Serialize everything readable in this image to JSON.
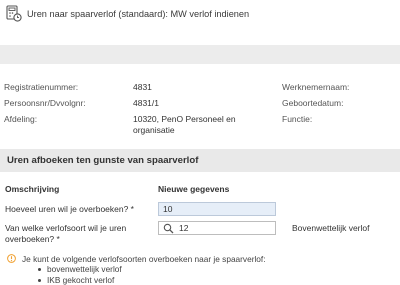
{
  "header": {
    "title": "Uren naar spaarverlof (standaard): MW verlof indienen",
    "icon": "calculator-clock-icon"
  },
  "info": {
    "registratienummer": {
      "label": "Registratienummer:",
      "value": "4831"
    },
    "persoonsnr": {
      "label": "Persoonsnr/Dvvolgnr:",
      "value": "4831/1"
    },
    "afdeling": {
      "label": "Afdeling:",
      "value_line1": "10320, PenO Personeel en",
      "value_line2": "organisatie"
    },
    "werknemernaam": {
      "label": "Werknemernaam:"
    },
    "geboortedatum": {
      "label": "Geboortedatum:"
    },
    "functie": {
      "label": "Functie:"
    }
  },
  "section": {
    "title": "Uren afboeken ten gunste van spaarverlof"
  },
  "form": {
    "col_omschrijving": "Omschrijving",
    "col_nieuwe_gegevens": "Nieuwe gegevens",
    "hours_label": "Hoeveel uren wil je overboeken? *",
    "hours_value": "10",
    "type_label_line1": "Van welke verlofsoort wil je uren",
    "type_label_line2": "overboeken? *",
    "type_value": "12",
    "type_description": "Bovenwettelijk verlof"
  },
  "notice": {
    "text": "Je kunt de volgende verlofsoorten overboeken naar je spaarverlof:",
    "items": [
      "bovenwettelijk verlof",
      "IKB gekocht verlof"
    ],
    "icon": "warning-circle-icon"
  },
  "colors": {
    "accent_orange": "#f0a030",
    "input_fill": "#e6eef8",
    "section_bg": "#e9e9e9"
  }
}
